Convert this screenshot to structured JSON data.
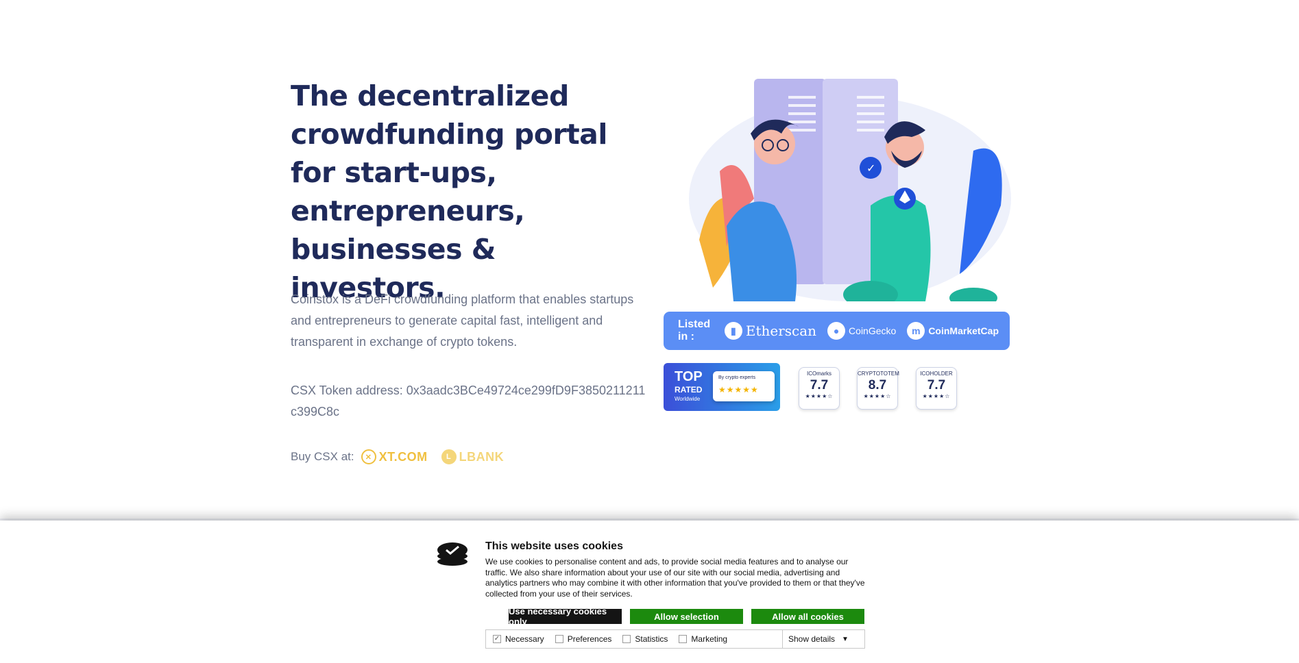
{
  "hero": {
    "title": "The decentralized crowdfunding portal for start-ups, entrepreneurs, businesses & investors.",
    "description": "Coinstox is a DeFi crowdfunding platform that enables startups and entrepreneurs to generate capital fast, intelligent and transparent in exchange of crypto tokens.",
    "token_address": "CSX Token address: 0x3aadc3BCe49724ce299fD9F3850211211c399C8c",
    "buy_label": "Buy CSX at:",
    "exchanges": [
      "XT.COM",
      "LBANK"
    ]
  },
  "listed": {
    "label": "Listed in :",
    "sites": [
      "Etherscan",
      "CoinGecko",
      "CoinMarketCap"
    ]
  },
  "badges": {
    "top_rated": {
      "line1": "TOP",
      "line2": "RATED",
      "line3": "Worldwide",
      "card": "By crypto experts",
      "stars": "★★★★★"
    },
    "ratings": [
      {
        "name": "ICOmarks",
        "score": "7.7",
        "stars": "★★★★☆"
      },
      {
        "name": "CRYPTOTOTEM",
        "score": "8.7",
        "stars": "★★★★☆"
      },
      {
        "name": "ICOHOLDER",
        "score": "7.7",
        "stars": "★★★★☆"
      }
    ]
  },
  "cookies": {
    "title": "This website uses cookies",
    "text": "We use cookies to personalise content and ads, to provide social media features and to analyse our traffic. We also share information about your use of our site with our social media, advertising and analytics partners who may combine it with other information that you've provided to them or that they've collected from your use of their services.",
    "buttons": {
      "necessary": "Use necessary cookies only",
      "selection": "Allow selection",
      "all": "Allow all cookies"
    },
    "options": [
      {
        "label": "Necessary",
        "checked": true
      },
      {
        "label": "Preferences",
        "checked": false
      },
      {
        "label": "Statistics",
        "checked": false
      },
      {
        "label": "Marketing",
        "checked": false
      }
    ],
    "details": "Show details"
  },
  "colors": {
    "heading": "#1f2a5a",
    "listed_bg": "#5b8ef5",
    "accept_green": "#1c8a0e",
    "dark_button": "#141414",
    "exchange_gold": "#f0c040"
  }
}
